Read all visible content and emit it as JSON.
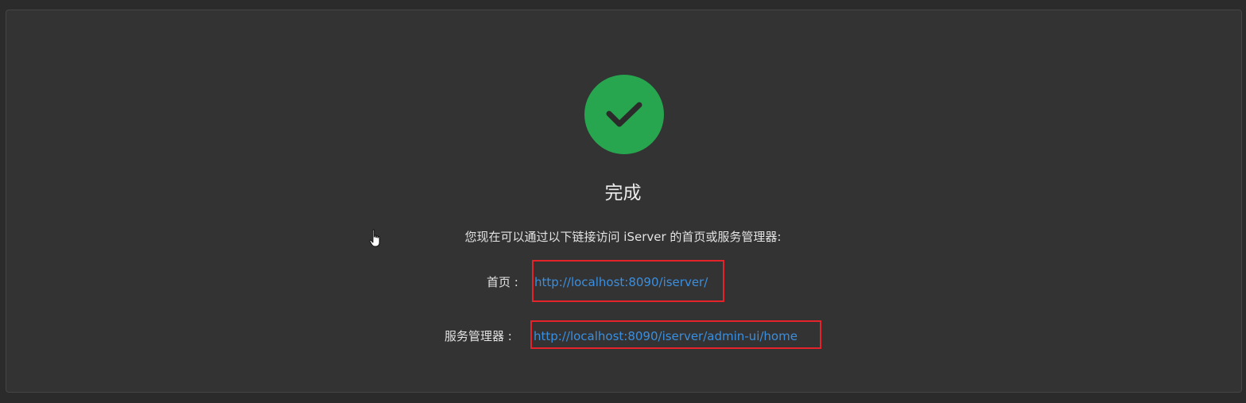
{
  "completion": {
    "title": "完成",
    "description": "您现在可以通过以下链接访问 iServer 的首页或服务管理器:",
    "links": [
      {
        "label": "首页 :",
        "url": "http://localhost:8090/iserver/"
      },
      {
        "label": "服务管理器 :",
        "url": "http://localhost:8090/iserver/admin-ui/home"
      }
    ]
  },
  "colors": {
    "page_background": "#2b2b2b",
    "panel_background": "#333333",
    "success_green": "#27a64f",
    "link_blue": "#3a8fe0",
    "highlight_red": "#e4232b",
    "text": "#e3e3e3"
  },
  "icons": {
    "status": "checkmark-icon",
    "pointer": "hand-cursor-icon"
  }
}
